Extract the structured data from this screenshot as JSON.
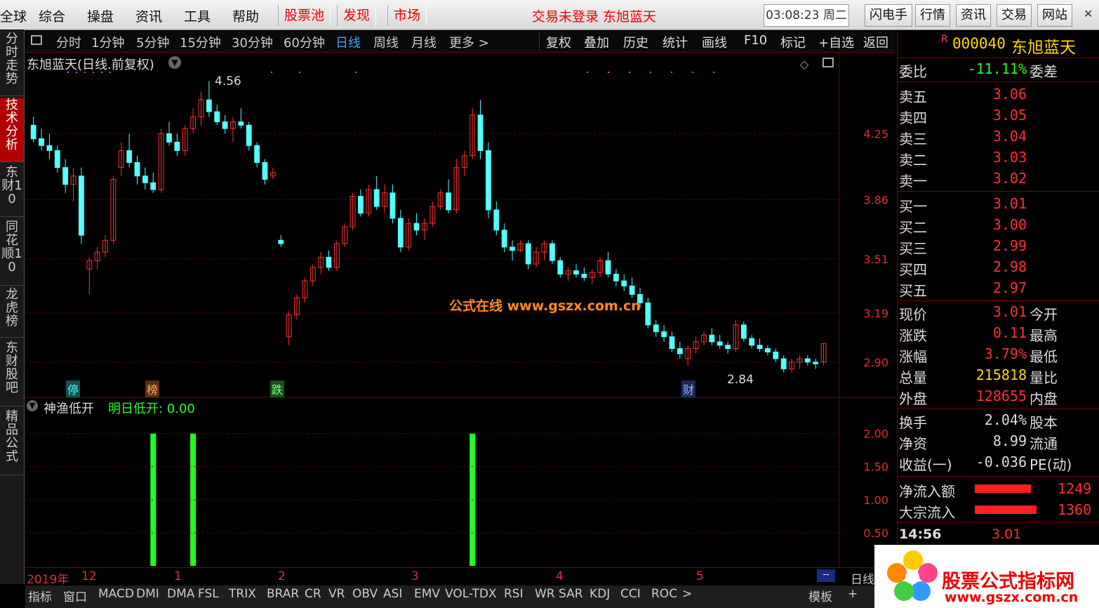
{
  "menu": {
    "items": [
      "全球",
      "综合",
      "操盘",
      "资讯",
      "工具",
      "帮助"
    ],
    "red_items": [
      "股票池",
      "发现",
      "市场"
    ],
    "login_text": "交易未登录 东旭蓝天",
    "clock": "03:08:23 周二",
    "right_buttons": [
      "闪电手",
      "行情",
      "资讯",
      "交易",
      "网站"
    ]
  },
  "left_tabs": [
    "分时走势",
    "技术分析",
    "东财10",
    "同花顺10",
    "龙虎榜",
    "东财股吧",
    "精品公式"
  ],
  "period_bar": {
    "periods": [
      "分时",
      "1分钟",
      "5分钟",
      "15分钟",
      "30分钟",
      "60分钟",
      "日线",
      "周线",
      "月线",
      "更多 >"
    ],
    "active": "日线",
    "right_items": [
      "复权",
      "叠加",
      "历史",
      "统计",
      "画线",
      "F10",
      "标记",
      "+自选",
      "返回"
    ]
  },
  "chart": {
    "title": "东旭蓝天(日线.前复权)",
    "high_label": "4.56",
    "low_label": "2.84",
    "price_ticks": [
      "4.25",
      "3.86",
      "3.51",
      "3.19",
      "2.90"
    ],
    "markers": [
      "停",
      "榜",
      "跌",
      "财"
    ],
    "watermark": "公式在线 www.gszx.com.cn",
    "colors": {
      "up": "#ff3232",
      "down": "#54ffff",
      "grid": "#7a0000",
      "signal": "#22ff22"
    }
  },
  "chart_data": {
    "type": "candlestick",
    "title": "东旭蓝天(日线.前复权)",
    "yticks": [
      4.25,
      3.86,
      3.51,
      3.19,
      2.9
    ],
    "ohlc": [
      [
        4.3,
        4.35,
        4.2,
        4.22
      ],
      [
        4.22,
        4.28,
        4.15,
        4.18
      ],
      [
        4.18,
        4.25,
        4.1,
        4.15
      ],
      [
        4.15,
        4.18,
        4.02,
        4.05
      ],
      [
        4.05,
        4.1,
        3.9,
        3.95
      ],
      [
        3.95,
        4.05,
        3.85,
        4.0
      ],
      [
        4.0,
        4.05,
        3.6,
        3.65
      ],
      [
        3.45,
        3.52,
        3.3,
        3.5
      ],
      [
        3.5,
        3.58,
        3.45,
        3.55
      ],
      [
        3.55,
        3.65,
        3.52,
        3.62
      ],
      [
        3.62,
        4.0,
        3.6,
        3.98
      ],
      [
        4.05,
        4.2,
        4.0,
        4.15
      ],
      [
        4.15,
        4.25,
        4.05,
        4.08
      ],
      [
        4.08,
        4.12,
        3.95,
        4.0
      ],
      [
        4.0,
        4.05,
        3.92,
        3.96
      ],
      [
        3.96,
        4.02,
        3.9,
        3.92
      ],
      [
        3.92,
        4.28,
        3.9,
        4.25
      ],
      [
        4.25,
        4.32,
        4.18,
        4.2
      ],
      [
        4.2,
        4.25,
        4.12,
        4.15
      ],
      [
        4.15,
        4.3,
        4.12,
        4.28
      ],
      [
        4.28,
        4.4,
        4.25,
        4.35
      ],
      [
        4.35,
        4.5,
        4.3,
        4.45
      ],
      [
        4.45,
        4.56,
        4.35,
        4.38
      ],
      [
        4.38,
        4.42,
        4.3,
        4.32
      ],
      [
        4.32,
        4.36,
        4.25,
        4.28
      ],
      [
        4.28,
        4.35,
        4.2,
        4.32
      ],
      [
        4.32,
        4.4,
        4.28,
        4.3
      ],
      [
        4.3,
        4.32,
        4.15,
        4.18
      ],
      [
        4.18,
        4.2,
        4.05,
        4.08
      ],
      [
        4.08,
        4.1,
        3.95,
        3.98
      ],
      [
        4.0,
        4.05,
        3.98,
        4.02
      ],
      [
        3.62,
        3.65,
        3.58,
        3.6
      ],
      [
        3.05,
        3.2,
        3.0,
        3.18
      ],
      [
        3.18,
        3.3,
        3.15,
        3.28
      ],
      [
        3.28,
        3.4,
        3.25,
        3.38
      ],
      [
        3.38,
        3.48,
        3.35,
        3.46
      ],
      [
        3.46,
        3.55,
        3.42,
        3.52
      ],
      [
        3.52,
        3.56,
        3.44,
        3.46
      ],
      [
        3.46,
        3.62,
        3.44,
        3.6
      ],
      [
        3.6,
        3.72,
        3.58,
        3.7
      ],
      [
        3.7,
        3.9,
        3.68,
        3.88
      ],
      [
        3.88,
        3.92,
        3.76,
        3.78
      ],
      [
        3.78,
        3.95,
        3.76,
        3.92
      ],
      [
        3.92,
        4.0,
        3.8,
        3.82
      ],
      [
        3.82,
        3.95,
        3.78,
        3.9
      ],
      [
        3.9,
        3.95,
        3.72,
        3.75
      ],
      [
        3.75,
        3.8,
        3.55,
        3.58
      ],
      [
        3.58,
        3.75,
        3.56,
        3.72
      ],
      [
        3.72,
        3.78,
        3.65,
        3.68
      ],
      [
        3.68,
        3.75,
        3.62,
        3.72
      ],
      [
        3.72,
        3.85,
        3.7,
        3.82
      ],
      [
        3.82,
        3.92,
        3.8,
        3.9
      ],
      [
        3.9,
        3.98,
        3.78,
        3.8
      ],
      [
        3.8,
        4.1,
        3.78,
        4.05
      ],
      [
        4.05,
        4.15,
        4.0,
        4.12
      ],
      [
        4.12,
        4.4,
        4.1,
        4.36
      ],
      [
        4.36,
        4.45,
        4.1,
        4.15
      ],
      [
        4.15,
        4.2,
        3.75,
        3.8
      ],
      [
        3.8,
        3.85,
        3.65,
        3.68
      ],
      [
        3.68,
        3.72,
        3.55,
        3.58
      ],
      [
        3.58,
        3.62,
        3.5,
        3.56
      ],
      [
        3.56,
        3.62,
        3.55,
        3.6
      ],
      [
        3.6,
        3.62,
        3.45,
        3.48
      ],
      [
        3.48,
        3.58,
        3.46,
        3.55
      ],
      [
        3.55,
        3.62,
        3.5,
        3.6
      ],
      [
        3.6,
        3.62,
        3.48,
        3.5
      ],
      [
        3.5,
        3.52,
        3.4,
        3.42
      ],
      [
        3.42,
        3.46,
        3.38,
        3.44
      ],
      [
        3.44,
        3.48,
        3.4,
        3.42
      ],
      [
        3.42,
        3.46,
        3.38,
        3.4
      ],
      [
        3.4,
        3.45,
        3.36,
        3.43
      ],
      [
        3.43,
        3.52,
        3.4,
        3.5
      ],
      [
        3.5,
        3.55,
        3.4,
        3.42
      ],
      [
        3.42,
        3.45,
        3.35,
        3.38
      ],
      [
        3.38,
        3.42,
        3.32,
        3.35
      ],
      [
        3.35,
        3.4,
        3.28,
        3.3
      ],
      [
        3.3,
        3.34,
        3.22,
        3.25
      ],
      [
        3.25,
        3.28,
        3.1,
        3.12
      ],
      [
        3.12,
        3.15,
        3.05,
        3.08
      ],
      [
        3.08,
        3.12,
        3.02,
        3.05
      ],
      [
        3.05,
        3.08,
        2.96,
        2.98
      ],
      [
        2.98,
        3.02,
        2.92,
        2.95
      ],
      [
        2.92,
        3.0,
        2.88,
        2.98
      ],
      [
        2.98,
        3.05,
        2.95,
        3.02
      ],
      [
        3.02,
        3.08,
        3.0,
        3.06
      ],
      [
        3.06,
        3.1,
        3.0,
        3.02
      ],
      [
        3.02,
        3.06,
        2.98,
        3.0
      ],
      [
        3.0,
        3.02,
        2.95,
        2.98
      ],
      [
        2.98,
        3.15,
        2.96,
        3.12
      ],
      [
        3.12,
        3.14,
        3.02,
        3.04
      ],
      [
        3.04,
        3.06,
        2.98,
        3.0
      ],
      [
        3.0,
        3.04,
        2.96,
        2.98
      ],
      [
        2.98,
        3.0,
        2.94,
        2.96
      ],
      [
        2.96,
        2.98,
        2.9,
        2.92
      ],
      [
        2.92,
        2.94,
        2.84,
        2.86
      ],
      [
        2.86,
        2.92,
        2.84,
        2.9
      ],
      [
        2.9,
        2.94,
        2.86,
        2.92
      ],
      [
        2.92,
        2.94,
        2.88,
        2.9
      ],
      [
        2.9,
        2.92,
        2.86,
        2.89
      ],
      [
        2.9,
        3.01,
        2.88,
        3.01
      ]
    ],
    "indicator": {
      "name": "神渔低开",
      "label": "明日低开: 0.00",
      "yticks": [
        2.0,
        1.5,
        1.0,
        0.5
      ],
      "signal_bars": [
        15,
        20,
        55
      ],
      "signal_value": 2.0
    },
    "x_labels": [
      "2019年",
      "12",
      "1",
      "2",
      "3",
      "4",
      "5"
    ]
  },
  "indicator_panel": {
    "name": "神渔低开",
    "label": "明日低开: 0.00",
    "yticks": [
      "2.00",
      "1.50",
      "1.00",
      "0.50"
    ]
  },
  "quote": {
    "code": "000040",
    "name": "东旭蓝天",
    "ratio_label": "委比",
    "ratio_value": "-11.11%",
    "diff_label": "委差",
    "asks": [
      {
        "label": "卖五",
        "price": "3.06"
      },
      {
        "label": "卖四",
        "price": "3.05"
      },
      {
        "label": "卖三",
        "price": "3.04"
      },
      {
        "label": "卖二",
        "price": "3.03"
      },
      {
        "label": "卖一",
        "price": "3.02"
      }
    ],
    "bids": [
      {
        "label": "买一",
        "price": "3.01"
      },
      {
        "label": "买二",
        "price": "3.00"
      },
      {
        "label": "买三",
        "price": "2.99"
      },
      {
        "label": "买四",
        "price": "2.98"
      },
      {
        "label": "买五",
        "price": "2.97"
      }
    ],
    "stats": [
      {
        "l": "现价",
        "v": "3.01",
        "r": "今开"
      },
      {
        "l": "涨跌",
        "v": "0.11",
        "r": "最高"
      },
      {
        "l": "涨幅",
        "v": "3.79%",
        "r": "最低"
      },
      {
        "l": "总量",
        "v": "215818",
        "r": "量比"
      },
      {
        "l": "外盘",
        "v": "128655",
        "r": "内盘"
      }
    ],
    "stats2": [
      {
        "l": "换手",
        "v": "2.04%",
        "r": "股本"
      },
      {
        "l": "净资",
        "v": "8.99",
        "r": "流通"
      },
      {
        "l": "收益(一)",
        "v": "-0.036",
        "r": "PE(动)"
      }
    ],
    "flows": [
      {
        "l": "净流入额",
        "v": "1249"
      },
      {
        "l": "大宗流入",
        "v": "1360"
      }
    ],
    "last_time": "14:56",
    "last_price": "3.01"
  },
  "bottom": {
    "x_labels": [
      "2019年",
      "12",
      "1",
      "2",
      "3",
      "4",
      "5"
    ],
    "period_tag": "日线",
    "indicator_tabs": [
      "指标",
      "窗口",
      "MACD",
      "DMI",
      "DMA",
      "FSL",
      "TRIX",
      "BRAR",
      "CR",
      "VR",
      "OBV",
      "ASI",
      "EMV",
      "VOL-TDX",
      "RSI",
      "WR",
      "SAR",
      "KDJ",
      "CCI",
      "ROC",
      ">"
    ],
    "template_label": "模板",
    "watermark": "股票公式指标网",
    "watermark_url": "www.gszx.com.cn"
  }
}
